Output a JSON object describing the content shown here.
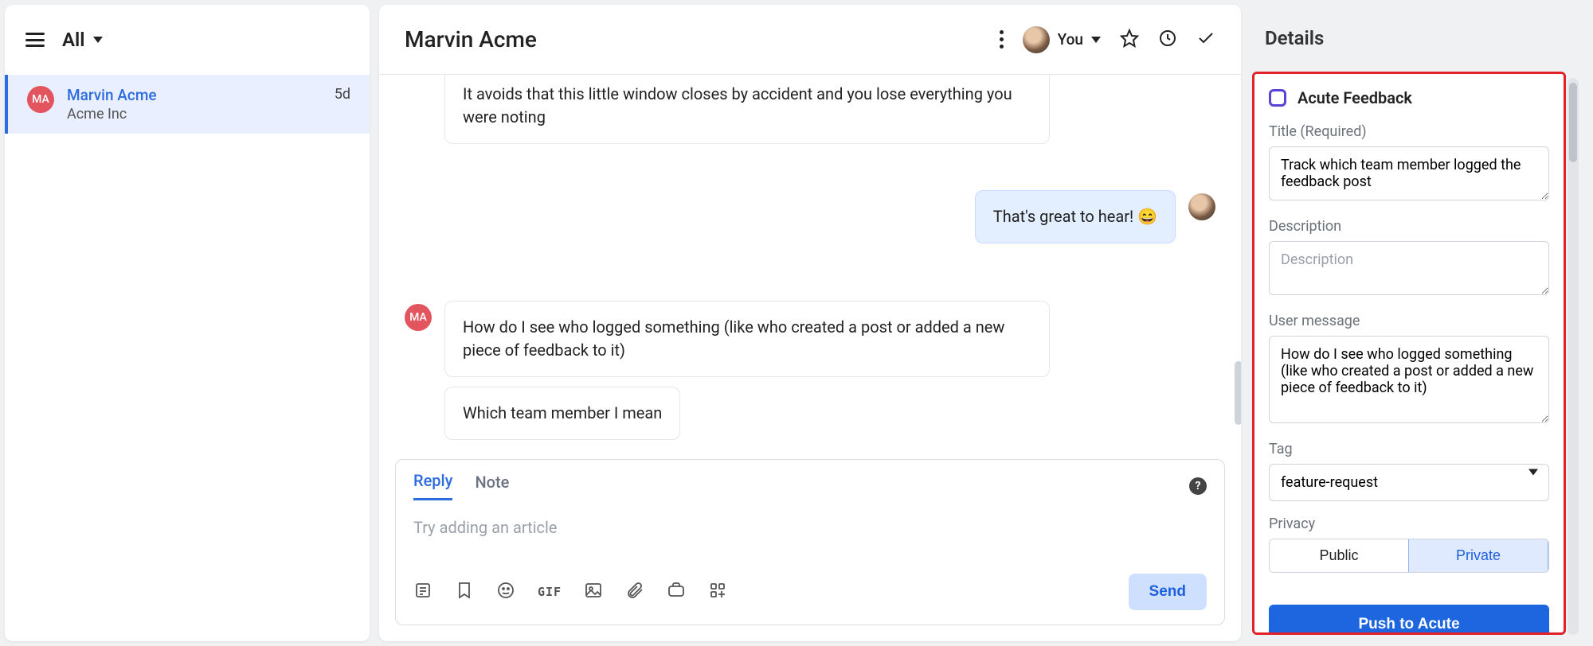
{
  "sidebar": {
    "filter_label": "All",
    "conversations": [
      {
        "initials": "MA",
        "name": "Marvin Acme",
        "company": "Acme Inc",
        "time": "5d"
      }
    ]
  },
  "chat": {
    "title": "Marvin Acme",
    "assignee_label": "You",
    "messages": {
      "m0_partial": "It avoids that this little window closes by accident and you lose everything you were noting",
      "m1_out": "That's great to hear! 😄",
      "m2_in": "How do I see who logged something (like who created a post or added a new piece of feedback to it)",
      "m3_in": "Which team member I mean"
    },
    "composer": {
      "tab_reply": "Reply",
      "tab_note": "Note",
      "placeholder": "Try adding an article",
      "send_label": "Send",
      "gif_label": "GIF"
    }
  },
  "details": {
    "panel_title": "Details",
    "card_title": "Acute Feedback",
    "title_label": "Title (Required)",
    "title_value": "Track which team member logged the feedback post",
    "description_label": "Description",
    "description_placeholder": "Description",
    "description_value": "",
    "user_message_label": "User message",
    "user_message_value": "How do I see who logged something (like who created a post or added a new piece of feedback to it)",
    "tag_label": "Tag",
    "tag_value": "feature-request",
    "privacy_label": "Privacy",
    "privacy_public": "Public",
    "privacy_private": "Private",
    "push_label": "Push to Acute"
  }
}
